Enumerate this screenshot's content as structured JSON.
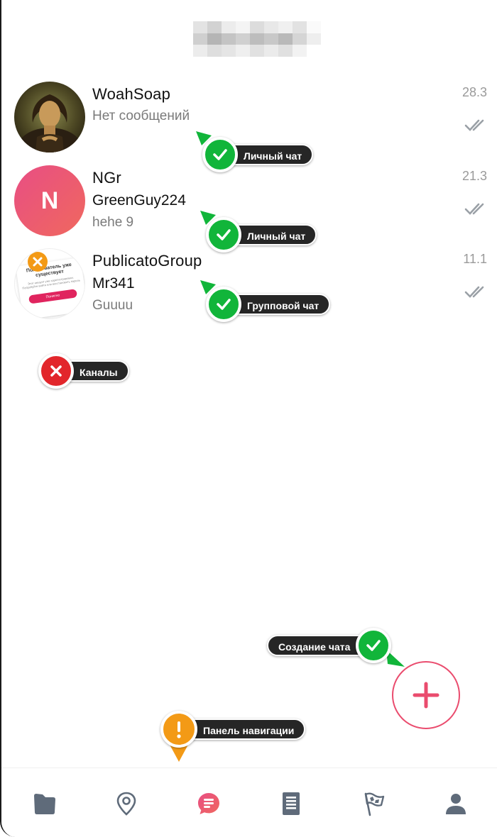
{
  "chats": [
    {
      "name": "WoahSoap",
      "subtitle": "Нет сообщений",
      "preview": "",
      "date": "28.3"
    },
    {
      "name": "NGr",
      "avatar_letter": "N",
      "subtitle": "GreenGuy224",
      "preview": "hehe 9",
      "date": "21.3"
    },
    {
      "name": "PublicatoGroup",
      "subtitle": "Mr341",
      "preview": "Guuuu",
      "date": "11.1",
      "avatar_card": {
        "title": "Пользователь уже существует",
        "body": "Этот аккаунт уже зарегистрирован. Попробуйте войти или восстановить пароль",
        "button": "Понятно"
      }
    }
  ],
  "annotations": {
    "chat1": "Личный чат",
    "chat2": "Личный чат",
    "chat3": "Групповой чат",
    "channels": "Каналы",
    "create_chat": "Создание чата",
    "nav_panel": "Панель навигации"
  },
  "nav": {
    "items": [
      "folder-icon",
      "location-pin-icon",
      "chat-icon",
      "document-icon",
      "flag-icon",
      "profile-icon"
    ],
    "active_index": 2
  },
  "colors": {
    "accent": "#ea4c6e",
    "ok": "#11b53a",
    "error": "#e2262b",
    "warning": "#f39a16",
    "nav_icon": "#5f6b7a"
  }
}
